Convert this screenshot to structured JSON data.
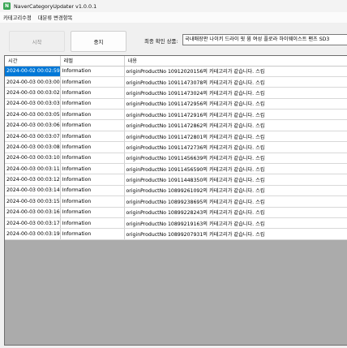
{
  "window": {
    "title": "NaverCategoryUpdater v1.0.0.1",
    "icon": "app-logo-icon",
    "icon_glyph": "N",
    "accent": "#3aa655"
  },
  "menu": {
    "items": [
      "카테고리수정",
      "대분류 변경항목"
    ]
  },
  "toolbar": {
    "start_label": "시작",
    "stop_label": "중지",
    "last_label": "최종 확인 상품:",
    "last_value": "국내매장판 나이키 드라이 핏 윔 여성 플로라 하이웨이스트 팬츠 SD3"
  },
  "grid": {
    "headers": [
      "시간",
      "레벨",
      "내용"
    ],
    "selection_color": "#0078d7",
    "rows": [
      {
        "time": "2024-00-02 00:02:59",
        "level": "Information",
        "message": "originProductNo 10912020156의 카테고리가 같습니다. 스킵",
        "selected": true
      },
      {
        "time": "2024-00-03 00:03:00",
        "level": "Information",
        "message": "originProductNo 10911473078의 카테고리가 같습니다. 스킵"
      },
      {
        "time": "2024-00-03 00:03:02",
        "level": "Information",
        "message": "originProductNo 10911473024의 카테고리가 같습니다. 스킵"
      },
      {
        "time": "2024-00-03 00:03:03",
        "level": "Information",
        "message": "originProductNo 10911472956의 카테고리가 같습니다. 스킵"
      },
      {
        "time": "2024-00-03 00:03:05",
        "level": "Information",
        "message": "originProductNo 10911472916의 카테고리가 같습니다. 스킵"
      },
      {
        "time": "2024-00-03 00:03:06",
        "level": "Information",
        "message": "originProductNo 10911472862의 카테고리가 같습니다. 스킵"
      },
      {
        "time": "2024-00-03 00:03:07",
        "level": "Information",
        "message": "originProductNo 10911472801의 카테고리가 같습니다. 스킵"
      },
      {
        "time": "2024-00-03 00:03:08",
        "level": "Information",
        "message": "originProductNo 10911472736의 카테고리가 같습니다. 스킵"
      },
      {
        "time": "2024-00-03 00:03:10",
        "level": "Information",
        "message": "originProductNo 10911456639의 카테고리가 같습니다. 스킵"
      },
      {
        "time": "2024-00-03 00:03:11",
        "level": "Information",
        "message": "originProductNo 10911456590의 카테고리가 같습니다. 스킵"
      },
      {
        "time": "2024-00-03 00:03:12",
        "level": "Information",
        "message": "originProductNo 10911448350의 카테고리가 같습니다. 스킵"
      },
      {
        "time": "2024-00-03 00:03:14",
        "level": "Information",
        "message": "originProductNo 10899261092의 카테고리가 같습니다. 스킵"
      },
      {
        "time": "2024-00-03 00:03:15",
        "level": "Information",
        "message": "originProductNo 10899238695의 카테고리가 같습니다. 스킵"
      },
      {
        "time": "2024-00-03 00:03:16",
        "level": "Information",
        "message": "originProductNo 10899228243의 카테고리가 같습니다. 스킵"
      },
      {
        "time": "2024-00-03 00:03:17",
        "level": "Information",
        "message": "originProductNo 10899219163의 카테고리가 같습니다. 스킵"
      },
      {
        "time": "2024-00-03 00:03:19",
        "level": "Information",
        "message": "originProductNo 10899207931의 카테고리가 같습니다. 스킵"
      }
    ]
  }
}
